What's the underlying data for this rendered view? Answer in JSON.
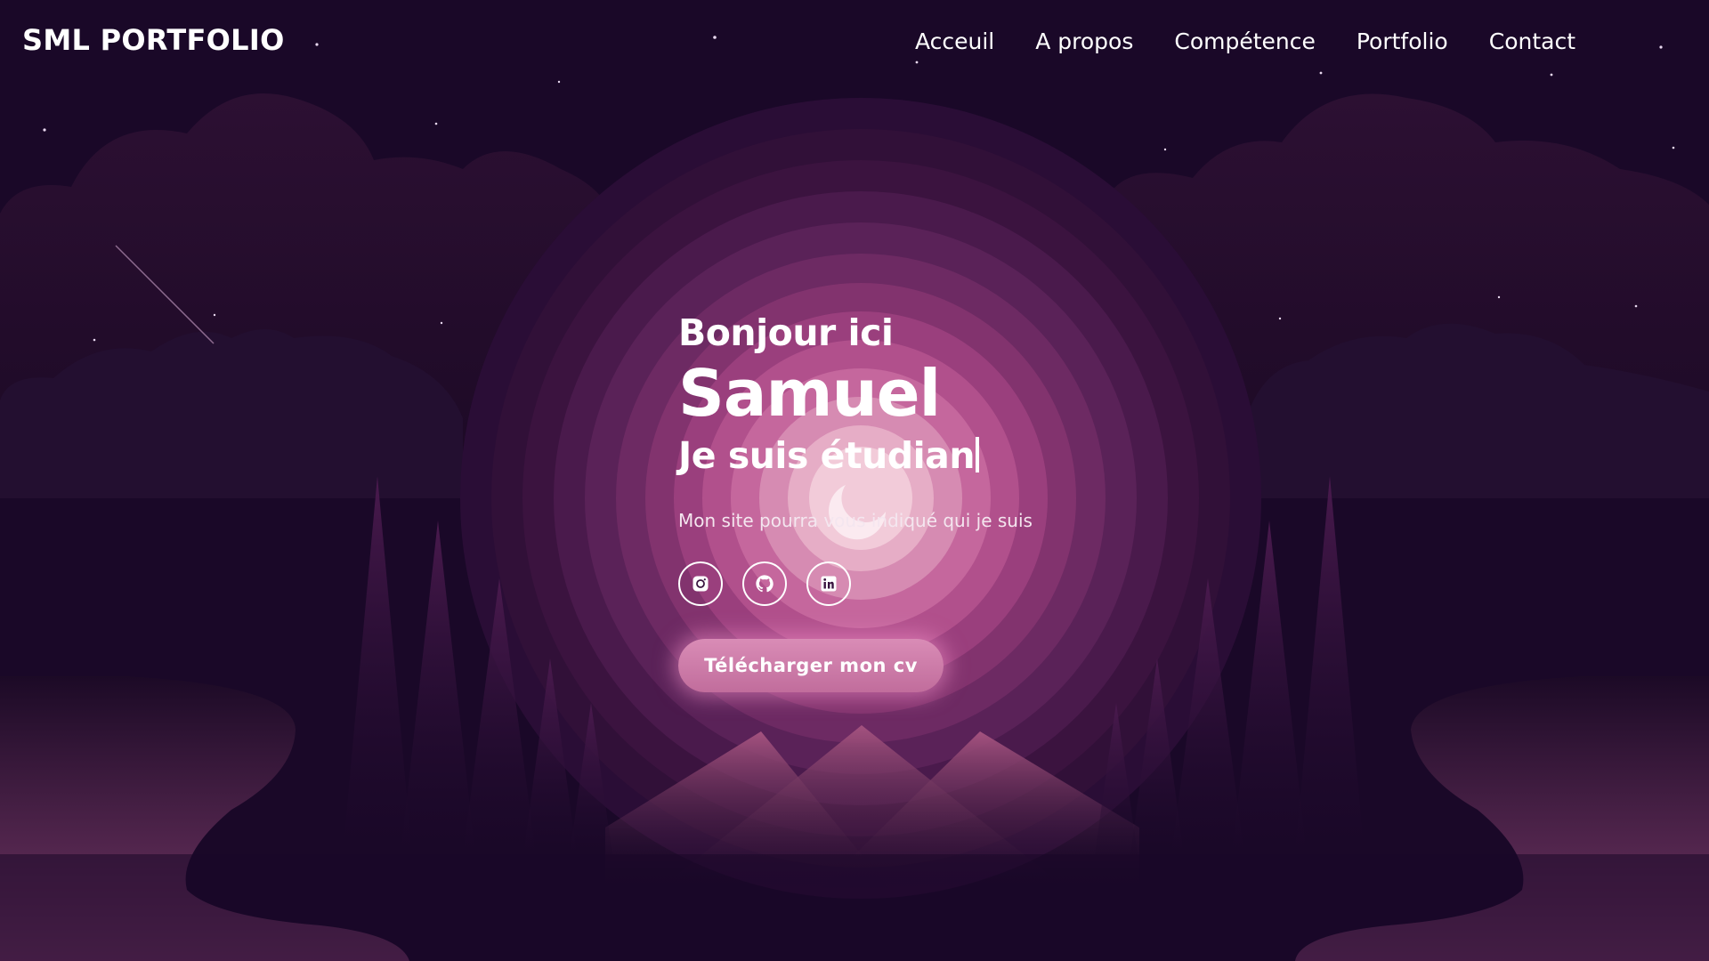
{
  "brand": "SML PORTFOLIO",
  "nav": {
    "items": [
      "Acceuil",
      "A propos",
      "Compétence",
      "Portfolio",
      "Contact"
    ]
  },
  "hero": {
    "greeting": "Bonjour ici",
    "name": "Samuel",
    "role_typed": "Je suis étudian",
    "tagline": "Mon site pourra vous indiqué qui je suis",
    "cv_button": "Télécharger mon cv"
  },
  "socials": [
    {
      "icon": "instagram-icon"
    },
    {
      "icon": "github-icon"
    },
    {
      "icon": "linkedin-icon"
    }
  ],
  "colors": {
    "background": "#1a0828",
    "glow_center": "#f7d3e1",
    "glow_pink": "#c0588e",
    "button": "#cf7eab"
  }
}
